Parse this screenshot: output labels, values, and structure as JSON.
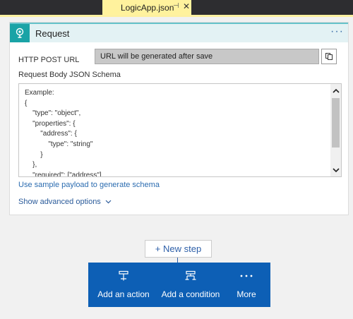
{
  "tab": {
    "title": "LogicApp.json",
    "pin_glyph": "⊣",
    "close_glyph": "✕"
  },
  "card": {
    "title": "Request",
    "more_glyph": "···",
    "url_label": "HTTP POST URL",
    "url_value": "URL will be generated after save",
    "schema_label": "Request Body JSON Schema",
    "schema_text": "Example:\n{\n    \"type\": \"object\",\n    \"properties\": {\n        \"address\": {\n            \"type\": \"string\"\n        }\n    },\n    \"required\": [\"address\"]\n}",
    "sample_link": "Use sample payload to generate schema",
    "advanced_link": "Show advanced options"
  },
  "new_step": {
    "label": "+ New step"
  },
  "actions": [
    {
      "label": "Add an action"
    },
    {
      "label": "Add a condition"
    },
    {
      "label": "More"
    }
  ],
  "colors": {
    "accent": "#0d5fb5",
    "header_bg": "#e3f2f4",
    "header_icon": "#1aa3a6",
    "tab_active": "#fff29d"
  }
}
